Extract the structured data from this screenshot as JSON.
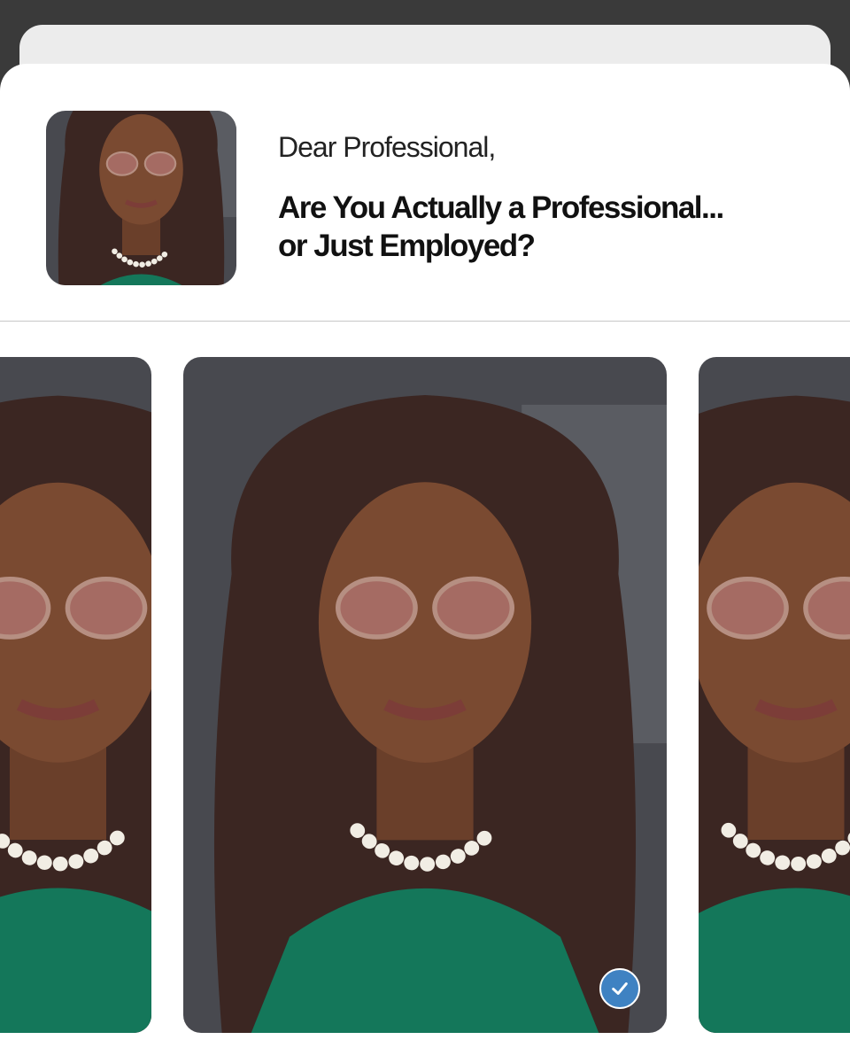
{
  "letter": {
    "greeting": "Dear Professional,",
    "headline_line1": "Are You Actually a Professional...",
    "headline_line2": "or Just Employed?"
  },
  "photos": [
    {
      "position": "left",
      "selected": false
    },
    {
      "position": "center",
      "selected": true
    },
    {
      "position": "right",
      "selected": false
    }
  ],
  "colors": {
    "background": "#3a3a3a",
    "card": "#ffffff",
    "selected_check": "#3f82c2",
    "top_green": "#14775a",
    "hair": "#3b2622"
  },
  "icons": [
    "check-icon"
  ]
}
